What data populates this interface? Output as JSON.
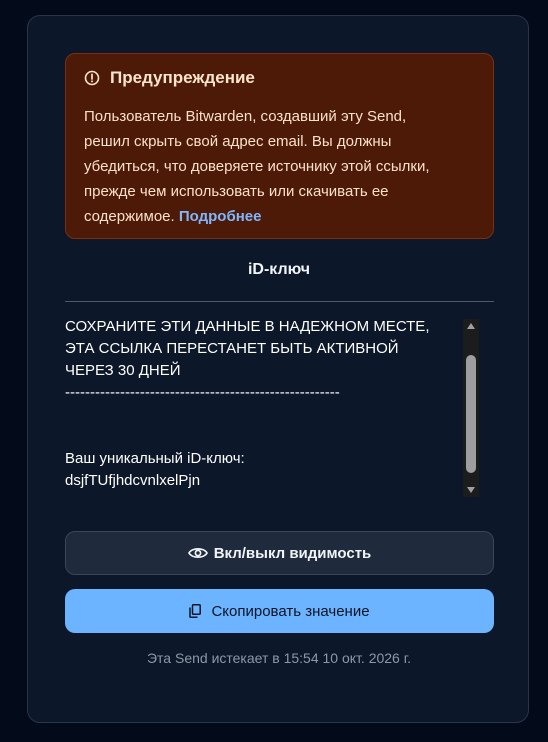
{
  "warning": {
    "icon": "exclamation-circle-icon",
    "title": "Предупреждение",
    "body": "Пользователь Bitwarden, создавший эту Send, решил скрыть свой адрес email. Вы должны убедиться, что доверяете источнику этой ссылки, прежде чем использовать или скачивать ее содержимое.",
    "link": "Подробнее"
  },
  "field": {
    "label": "iD-ключ",
    "lines": [
      "СОХРАНИТЕ ЭТИ ДАННЫЕ В НАДЕЖНОМ МЕСТЕ,",
      "ЭТА ССЫЛКА ПЕРЕСТАНЕТ БЫТЬ АКТИВНОЙ",
      "ЧЕРЕЗ 30 ДНЕЙ",
      "-------------------------------------------------------",
      "",
      "",
      "Ваш уникальный iD-ключ:",
      "dsjfTUfjhdcvnlxelPjn"
    ]
  },
  "buttons": {
    "visibility": {
      "icon": "eye-icon",
      "label": "Вкл/выкл видимость"
    },
    "copy": {
      "icon": "copy-icon",
      "label": "Скопировать значение"
    }
  },
  "expiry": "Эта Send истекает в 15:54 10 окт. 2026 г.",
  "colors": {
    "background": "#030a1a",
    "card": "#0c1729",
    "warning_bg": "#4c1a07",
    "accent": "#6cb4ff",
    "link": "#7fb7ff"
  }
}
